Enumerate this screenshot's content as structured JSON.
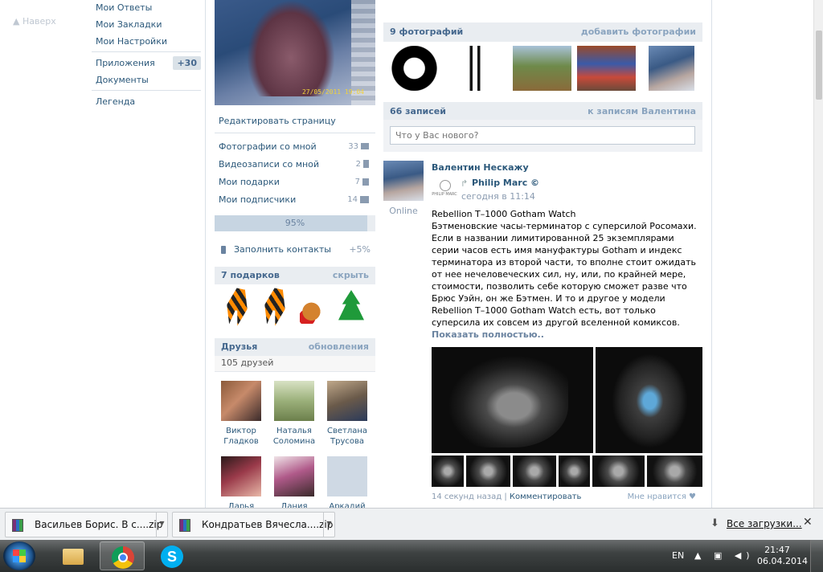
{
  "top": {
    "up_link": "▲ Наверх"
  },
  "nav": {
    "items": [
      {
        "label": "Мои Ответы"
      },
      {
        "label": "Мои Закладки"
      },
      {
        "label": "Мои Настройки"
      },
      {
        "label": "Приложения",
        "badge": "+30"
      },
      {
        "label": "Документы"
      },
      {
        "label": "Легенда"
      }
    ]
  },
  "profile": {
    "avatar_date": "27/05/2011  19:04",
    "edit_label": "Редактировать страницу",
    "links": [
      {
        "label": "Фотографии со мной",
        "count": "33",
        "icon": "camera-icon"
      },
      {
        "label": "Видеозаписи со мной",
        "count": "2",
        "icon": "film-icon"
      },
      {
        "label": "Мои подарки",
        "count": "7",
        "icon": "gift-icon"
      },
      {
        "label": "Мои подписчики",
        "count": "14",
        "icon": "people-icon"
      }
    ],
    "completion": {
      "label": "95%",
      "fraction": 0.95
    },
    "fill_contacts": {
      "label": "Заполнить контакты",
      "bonus": "+5%"
    },
    "gifts": {
      "title": "7 подарков",
      "action": "скрыть",
      "items": [
        "ribbon",
        "ribbon",
        "deer",
        "tree"
      ]
    },
    "friends": {
      "title": "Друзья",
      "action": "обновления",
      "count_label": "105 друзей",
      "items": [
        {
          "first": "Виктор",
          "last": "Гладков"
        },
        {
          "first": "Наталья",
          "last": "Соломина"
        },
        {
          "first": "Светлана",
          "last": "Трусова"
        },
        {
          "first": "Дарья",
          "last": ""
        },
        {
          "first": "Дания",
          "last": ""
        },
        {
          "first": "Аркадий",
          "last": ""
        }
      ]
    }
  },
  "photos": {
    "title": "9 фотографий",
    "action": "добавить фотографии"
  },
  "wall": {
    "title": "66 записей",
    "action": "к записям Валентина",
    "input_placeholder": "Что у Вас нового?",
    "post": {
      "author": "Валентин Нескажу",
      "status": "Online",
      "repost_from": "Philip Marc ©",
      "repost_logo_text": "PHILIP MARC",
      "repost_time": "сегодня в 11:14",
      "text": "Rebellion T–1000 Gotham Watch\nБэтменовские часы-терминатор с суперсилой Росомахи.\nЕсли в названии лимитированной 25 экземплярами серии часов есть имя мануфактуры Gotham и индекс терминатора из второй части, то вполне стоит ожидать от нее нечеловеческих сил, ну, или, по крайней мере, стоимости, позволить себе которую сможет разве что Брюс Уэйн, он же Бэтмен. И то и другое у модели Rebellion T–1000 Gotham Watch есть, вот только суперсила их совсем из другой вселенной комиксов.",
      "show_full": "Показать полностью..",
      "time_ago": "14 секунд назад",
      "sep": "|",
      "comment": "Комментировать",
      "like": "Мне нравится ♥"
    }
  },
  "downloads": {
    "items": [
      {
        "name": "Васильев Борис. В с....zip"
      },
      {
        "name": "Кондратьев Вячесла....zip"
      }
    ],
    "all_label": "Все загрузки...",
    "close": "✕",
    "all_icon": "⬇"
  },
  "taskbar": {
    "lang": "EN",
    "tray": "▲ ▣ ◀)",
    "time": "21:47",
    "date": "06.04.2014"
  }
}
